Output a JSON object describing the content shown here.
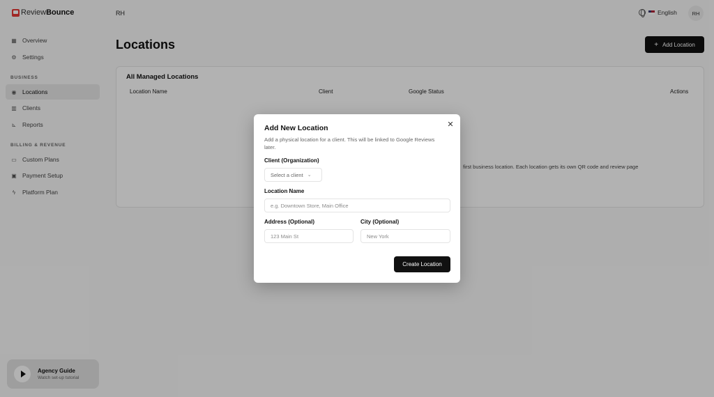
{
  "brand": {
    "part1": "Review",
    "part2": "Bounce"
  },
  "topbar": {
    "user_initials": "RH",
    "language": "English",
    "avatar_initials": "RH"
  },
  "sidebar": {
    "items": [
      {
        "label": "Overview",
        "icon": "grid-icon"
      },
      {
        "label": "Settings",
        "icon": "gear-icon"
      }
    ],
    "section_business": "BUSINESS",
    "business_items": [
      {
        "label": "Locations",
        "icon": "pin-icon",
        "active": true
      },
      {
        "label": "Clients",
        "icon": "building-icon"
      },
      {
        "label": "Reports",
        "icon": "chart-icon"
      }
    ],
    "section_billing": "BILLING & REVENUE",
    "billing_items": [
      {
        "label": "Custom Plans",
        "icon": "card-icon"
      },
      {
        "label": "Payment Setup",
        "icon": "money-icon"
      },
      {
        "label": "Platform Plan",
        "icon": "bolt-icon"
      }
    ],
    "guide": {
      "title": "Agency Guide",
      "subtitle": "Watch set-up tutorial"
    }
  },
  "main": {
    "title": "Locations",
    "add_button": "Add Location",
    "card_title": "All Managed Locations",
    "columns": [
      "Location Name",
      "Client",
      "Google Status",
      "Actions"
    ],
    "empty_text": "first business location. Each location gets its own QR code and review page"
  },
  "modal": {
    "title": "Add New Location",
    "description": "Add a physical location for a client. This will be linked to Google Reviews later.",
    "client_label": "Client (Organization)",
    "client_placeholder": "Select a client",
    "location_label": "Location Name",
    "location_placeholder": "e.g. Downtown Store, Main Office",
    "address_label": "Address (Optional)",
    "address_placeholder": "123 Main St",
    "city_label": "City (Optional)",
    "city_placeholder": "New York",
    "submit": "Create Location"
  }
}
